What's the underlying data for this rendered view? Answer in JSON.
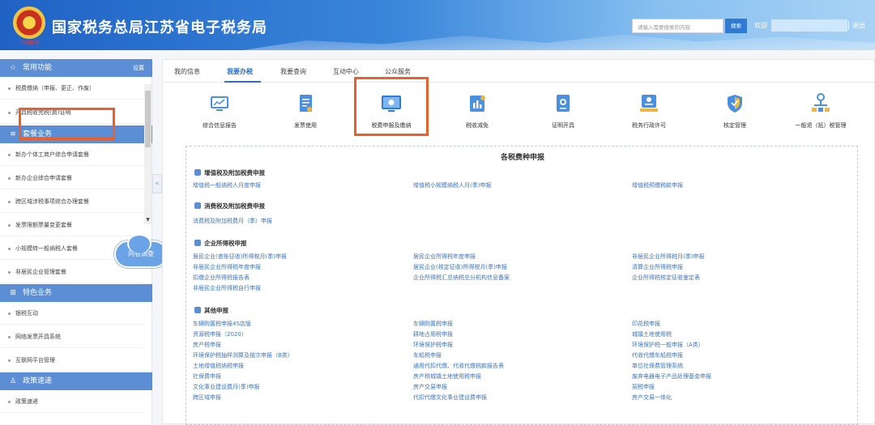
{
  "header": {
    "title": "国家税务总局江苏省电子税务局",
    "emblem_text": "中国税务",
    "search_placeholder": "请输入需要搜索的内容",
    "search_button": "搜索",
    "welcome": "欢迎",
    "logout": "退出"
  },
  "sidebar": {
    "sections": [
      {
        "title": "常用功能",
        "setting": "设置",
        "items": [
          "税费缴纳（申报、更正、作废）",
          "开具税收完税(费)证明"
        ]
      },
      {
        "title": "套餐业务",
        "items": [
          "新办个体工商户综合申请套餐",
          "新办企业综合申请套餐",
          "跨区域涉税事项综合办理套餐",
          "发票限额票量变更套餐",
          "小规模转一般纳税人套餐",
          "非居民企业管理套餐"
        ]
      },
      {
        "title": "特色业务",
        "items": [
          "银税互动",
          "网络发票开具系统",
          "互联网平台管理"
        ]
      },
      {
        "title": "政策速递",
        "items": [
          "政策速递"
        ]
      }
    ],
    "collapse": "«",
    "survey": "问卷调查"
  },
  "tabs": [
    "我的信息",
    "我要办税",
    "我要查询",
    "互动中心",
    "公众服务"
  ],
  "active_tab": "我要办税",
  "categories": [
    {
      "label": "综合信息报告",
      "icon": "monitor-chart-icon"
    },
    {
      "label": "发票使用",
      "icon": "invoice-icon"
    },
    {
      "label": "税费申报及缴纳",
      "icon": "screen-icon"
    },
    {
      "label": "税收减免",
      "icon": "reduction-icon"
    },
    {
      "label": "证明开具",
      "icon": "certificate-icon"
    },
    {
      "label": "税务行政许可",
      "icon": "license-icon"
    },
    {
      "label": "核定管理",
      "icon": "shield-icon"
    },
    {
      "label": "一般退（抵）税管理",
      "icon": "flow-icon"
    }
  ],
  "panel": {
    "title": "各税费种申报",
    "groups": [
      {
        "title": "增值税及附加税费申报",
        "links": [
          "增值税一般纳税人月度申报",
          "增值税小规模纳税人月(季)申报",
          "增值税预缴税款申报"
        ]
      },
      {
        "title": "消费税及附加税费申报",
        "links": [
          "消费税及附加税费月（季）申报"
        ]
      },
      {
        "title": "企业所得税申报",
        "links": [
          "居民企业(查账征收)所得税月(季)申报",
          "居民企业所得税年度申报",
          "非居民企业所得税月(季)申报",
          "非居民企业所得税年度申报",
          "居民企业(核定征收)所得税月(季)申报",
          "清算企业所得税申报",
          "扣缴企业所得税报告表",
          "企业所得税汇总纳税总分机构信息备案",
          "企业所得税核定征收鉴定表",
          "非居民企业所得税自行申报"
        ]
      },
      {
        "title": "其他申报",
        "links": [
          "车辆购置税申报4S店版",
          "车辆购置税申报",
          "印花税申报",
          "资源税申报（2020）",
          "耕地占用税申报",
          "城镇土地使用税",
          "房产税申报",
          "环境保护税申报",
          "环境保护税一般申报（A类）",
          "环境保护税抽样测算及按次申报（B类）",
          "车船税申报",
          "代收代缴车船税申报",
          "土地增值税纳税申报",
          "通用代扣代缴、代收代缴税款报告表",
          "单位社保费管理系统",
          "社保费申报",
          "房产税城镇土地使用税申报",
          "废弃电器电子产品处理基金申报",
          "文化事业建设费月(季)申报",
          "房产交易申报",
          "契税申报",
          "跨区域申报",
          "代扣代缴文化事业建设费申报",
          "房产交易一体化"
        ]
      }
    ]
  },
  "colors": {
    "header_blue": "#1f62c4",
    "accent": "#2e6dc2",
    "highlight": "#e8602c",
    "link": "#3b74c6"
  }
}
